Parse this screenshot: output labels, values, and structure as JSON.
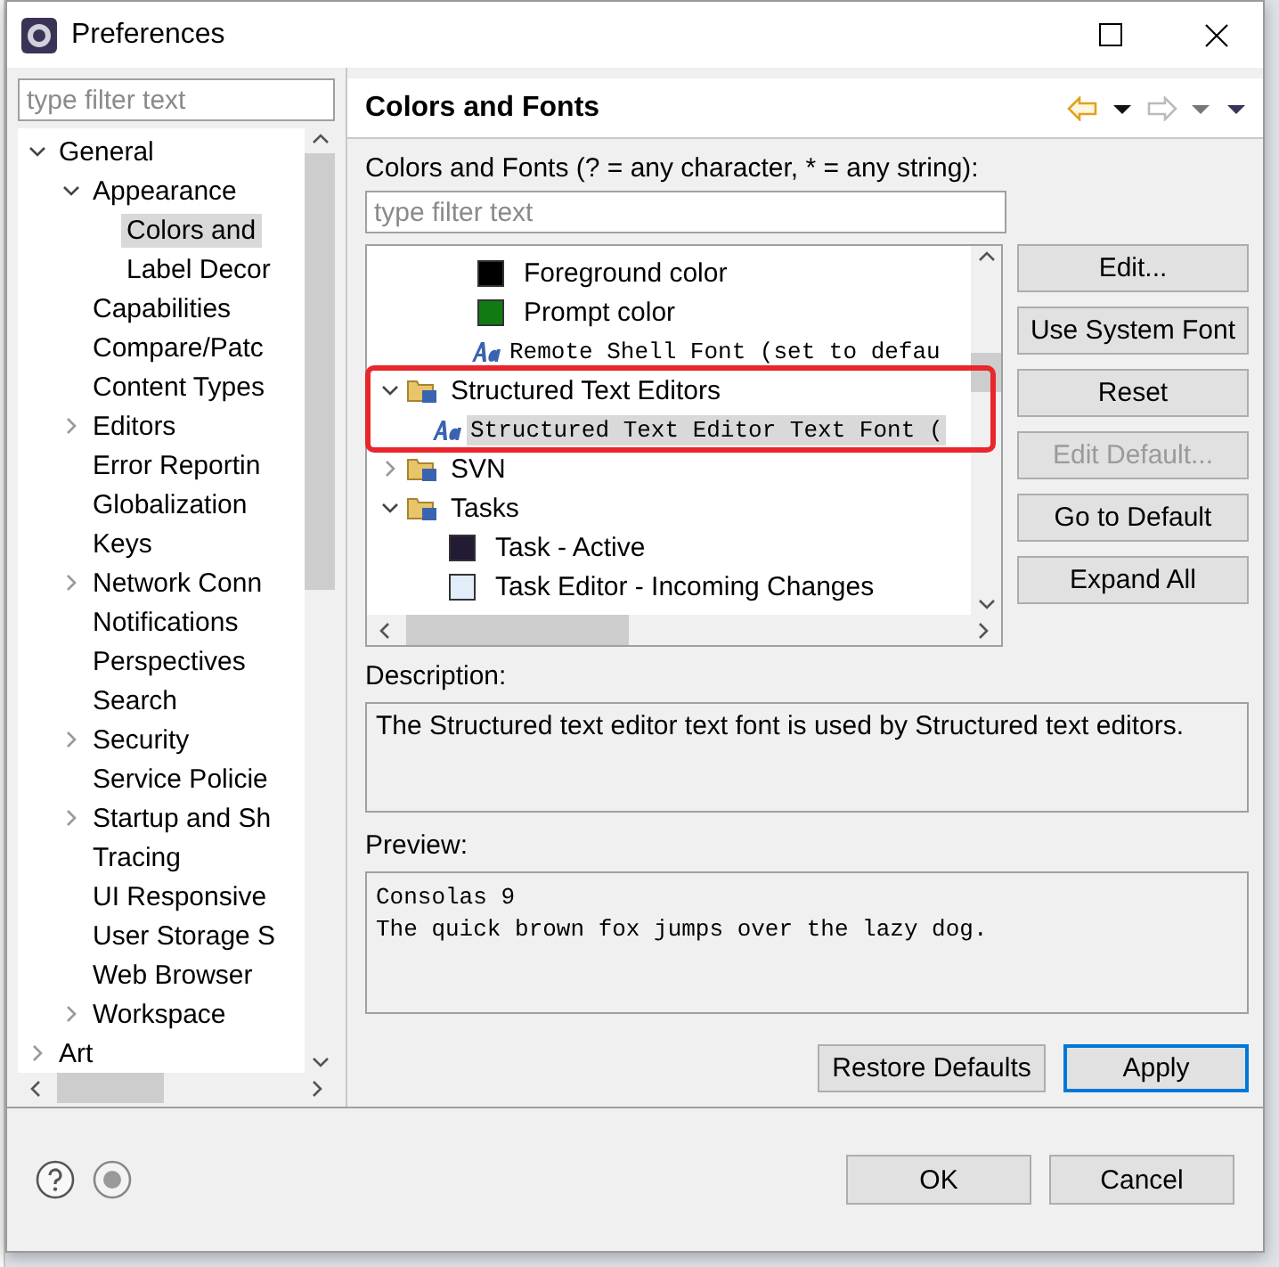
{
  "window": {
    "title": "Preferences"
  },
  "sidebar": {
    "filter": {
      "placeholder": "type filter text"
    },
    "tree": [
      {
        "label": "General",
        "expanded": true,
        "selected": false,
        "children": [
          {
            "label": "Appearance",
            "expanded": true,
            "selected": false,
            "children": [
              {
                "label": "Colors and",
                "selected": true
              },
              {
                "label": "Label Decor",
                "selected": false
              }
            ]
          },
          {
            "label": "Capabilities",
            "selected": false
          },
          {
            "label": "Compare/Patc",
            "selected": false
          },
          {
            "label": "Content Types",
            "selected": false
          },
          {
            "label": "Editors",
            "expanded": false,
            "selected": false
          },
          {
            "label": "Error Reportin",
            "selected": false
          },
          {
            "label": "Globalization",
            "selected": false
          },
          {
            "label": "Keys",
            "selected": false
          },
          {
            "label": "Network Conn",
            "expanded": false,
            "selected": false
          },
          {
            "label": "Notifications",
            "selected": false
          },
          {
            "label": "Perspectives",
            "selected": false
          },
          {
            "label": "Search",
            "selected": false
          },
          {
            "label": "Security",
            "expanded": false,
            "selected": false
          },
          {
            "label": "Service Policie",
            "selected": false
          },
          {
            "label": "Startup and Sh",
            "expanded": false,
            "selected": false
          },
          {
            "label": "Tracing",
            "selected": false
          },
          {
            "label": "UI Responsive",
            "selected": false
          },
          {
            "label": "User Storage S",
            "selected": false
          },
          {
            "label": "Web Browser",
            "selected": false
          },
          {
            "label": "Workspace",
            "expanded": false,
            "selected": false
          }
        ]
      },
      {
        "label": "Art",
        "expanded": false,
        "selected": false
      }
    ]
  },
  "page": {
    "title": "Colors and Fonts",
    "filter_label": "Colors and Fonts (? = any character, * = any string):",
    "filter": {
      "placeholder": "type filter text"
    },
    "tree": [
      {
        "kind": "color",
        "label": "Foreground color",
        "color": "#000000",
        "selected": false
      },
      {
        "kind": "color",
        "label": "Prompt color",
        "color": "#127a12",
        "selected": false
      },
      {
        "kind": "font",
        "label": "Remote Shell Font  (set to defau",
        "selected": false
      },
      {
        "kind": "category",
        "label": "Structured Text Editors",
        "expanded": true,
        "selected": false,
        "children": [
          {
            "kind": "font",
            "label": "Structured Text Editor Text Font (",
            "selected": true
          }
        ]
      },
      {
        "kind": "category",
        "label": "SVN",
        "expanded": false,
        "selected": false
      },
      {
        "kind": "category",
        "label": "Tasks",
        "expanded": true,
        "selected": false,
        "children": [
          {
            "kind": "color",
            "label": "Task - Active",
            "color": "#231a33",
            "selected": false
          },
          {
            "kind": "color",
            "label": "Task Editor - Incoming Changes",
            "color": "#e3edf9",
            "selected": false
          }
        ]
      }
    ],
    "buttons": [
      {
        "label": "Edit...",
        "disabled": false
      },
      {
        "label": "Use System Font",
        "disabled": false
      },
      {
        "label": "Reset",
        "disabled": false
      },
      {
        "label": "Edit Default...",
        "disabled": true
      },
      {
        "label": "Go to Default",
        "disabled": false
      },
      {
        "label": "Expand All",
        "disabled": false
      }
    ],
    "description_label": "Description:",
    "description": "The Structured text editor text font is used by Structured text editors.",
    "preview_label": "Preview:",
    "preview": [
      "Consolas 9",
      "The quick brown fox jumps over the lazy dog."
    ],
    "restore_button": "Restore Defaults",
    "apply_button": "Apply"
  },
  "dialog_buttons": [
    "OK",
    "Cancel"
  ]
}
